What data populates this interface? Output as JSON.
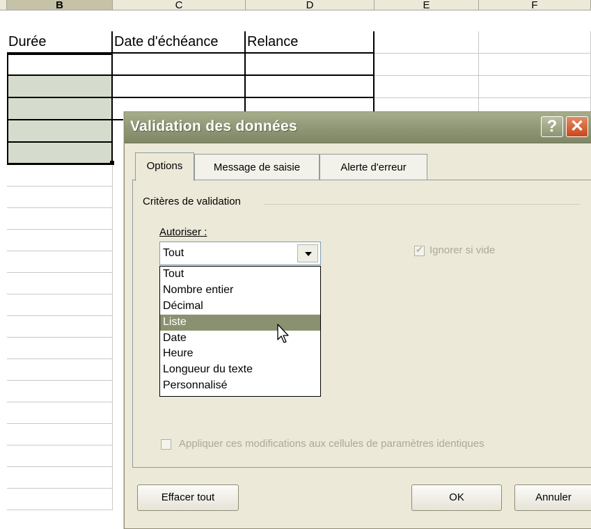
{
  "sheet": {
    "columns": [
      "B",
      "C",
      "D",
      "E",
      "F"
    ],
    "headers": {
      "b": "Durée",
      "c": "Date d'échéance",
      "d": "Relance"
    }
  },
  "dialog": {
    "title": "Validation des données",
    "help_glyph": "?",
    "close_glyph": "✕",
    "tabs": [
      "Options",
      "Message de saisie",
      "Alerte d'erreur"
    ],
    "group_label": "Critères de validation",
    "allow_label": "Autoriser :",
    "allow_value": "Tout",
    "allow_options": [
      "Tout",
      "Nombre entier",
      "Décimal",
      "Liste",
      "Date",
      "Heure",
      "Longueur du texte",
      "Personnalisé"
    ],
    "highlighted_option": "Liste",
    "ignore_blank_label": "Ignorer si vide",
    "apply_label": "Appliquer ces modifications aux cellules de paramètres identiques",
    "buttons": {
      "clear": "Effacer tout",
      "ok": "OK",
      "cancel": "Annuler"
    }
  },
  "colors": {
    "titlebar": "#8c9472",
    "highlight": "#8a9170",
    "selected_cells": "#d6dccd"
  }
}
